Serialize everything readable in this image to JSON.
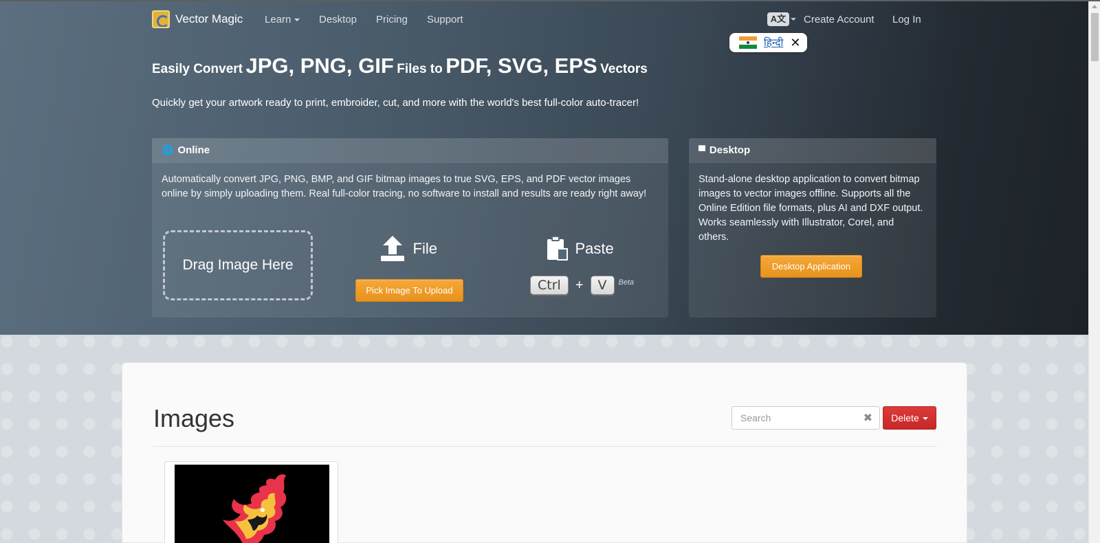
{
  "nav": {
    "brand": "Vector Magic",
    "links": [
      "Learn",
      "Desktop",
      "Pricing",
      "Support"
    ],
    "language_icon": "A文",
    "create_account": "Create Account",
    "log_in": "Log In"
  },
  "language_popup": {
    "label": "हिन्दी",
    "close": "✕"
  },
  "hero": {
    "headline_parts": [
      "Easily Convert",
      "JPG, PNG, GIF",
      "Files to",
      "PDF, SVG, EPS",
      "Vectors"
    ],
    "subline": "Quickly get your artwork ready to print, embroider, cut, and more with the world's best full-color auto-tracer!"
  },
  "online": {
    "title": "Online",
    "description": "Automatically convert JPG, PNG, BMP, and GIF bitmap images to true SVG, EPS, and PDF vector images online by simply uploading them. Real full-color tracing, no software to install and results are ready right away!",
    "drag_label": "Drag Image Here",
    "file_label": "File",
    "pick_button": "Pick Image To Upload",
    "paste_label": "Paste",
    "key_ctrl": "Ctrl",
    "key_plus": "+",
    "key_v": "V",
    "beta": "Beta"
  },
  "desktop": {
    "title": "Desktop",
    "description": "Stand-alone desktop application to convert bitmap images to vector images offline. Supports all the Online Edition file formats, plus AI and DXF output. Works seamlessly with Illustrator, Corel, and others.",
    "button": "Desktop Application"
  },
  "images": {
    "title": "Images",
    "search_placeholder": "Search",
    "clear_icon": "✖",
    "delete_button": "Delete"
  },
  "colors": {
    "accent_orange": "#ee9a25",
    "delete_red": "#d23131",
    "hero_dark": "#1c2227",
    "hero_light": "#5c6f80"
  },
  "icons": {
    "online": "globe-icon",
    "desktop": "monitor-icon",
    "file": "upload-icon",
    "paste": "clipboard-icon",
    "language": "translate-icon"
  }
}
